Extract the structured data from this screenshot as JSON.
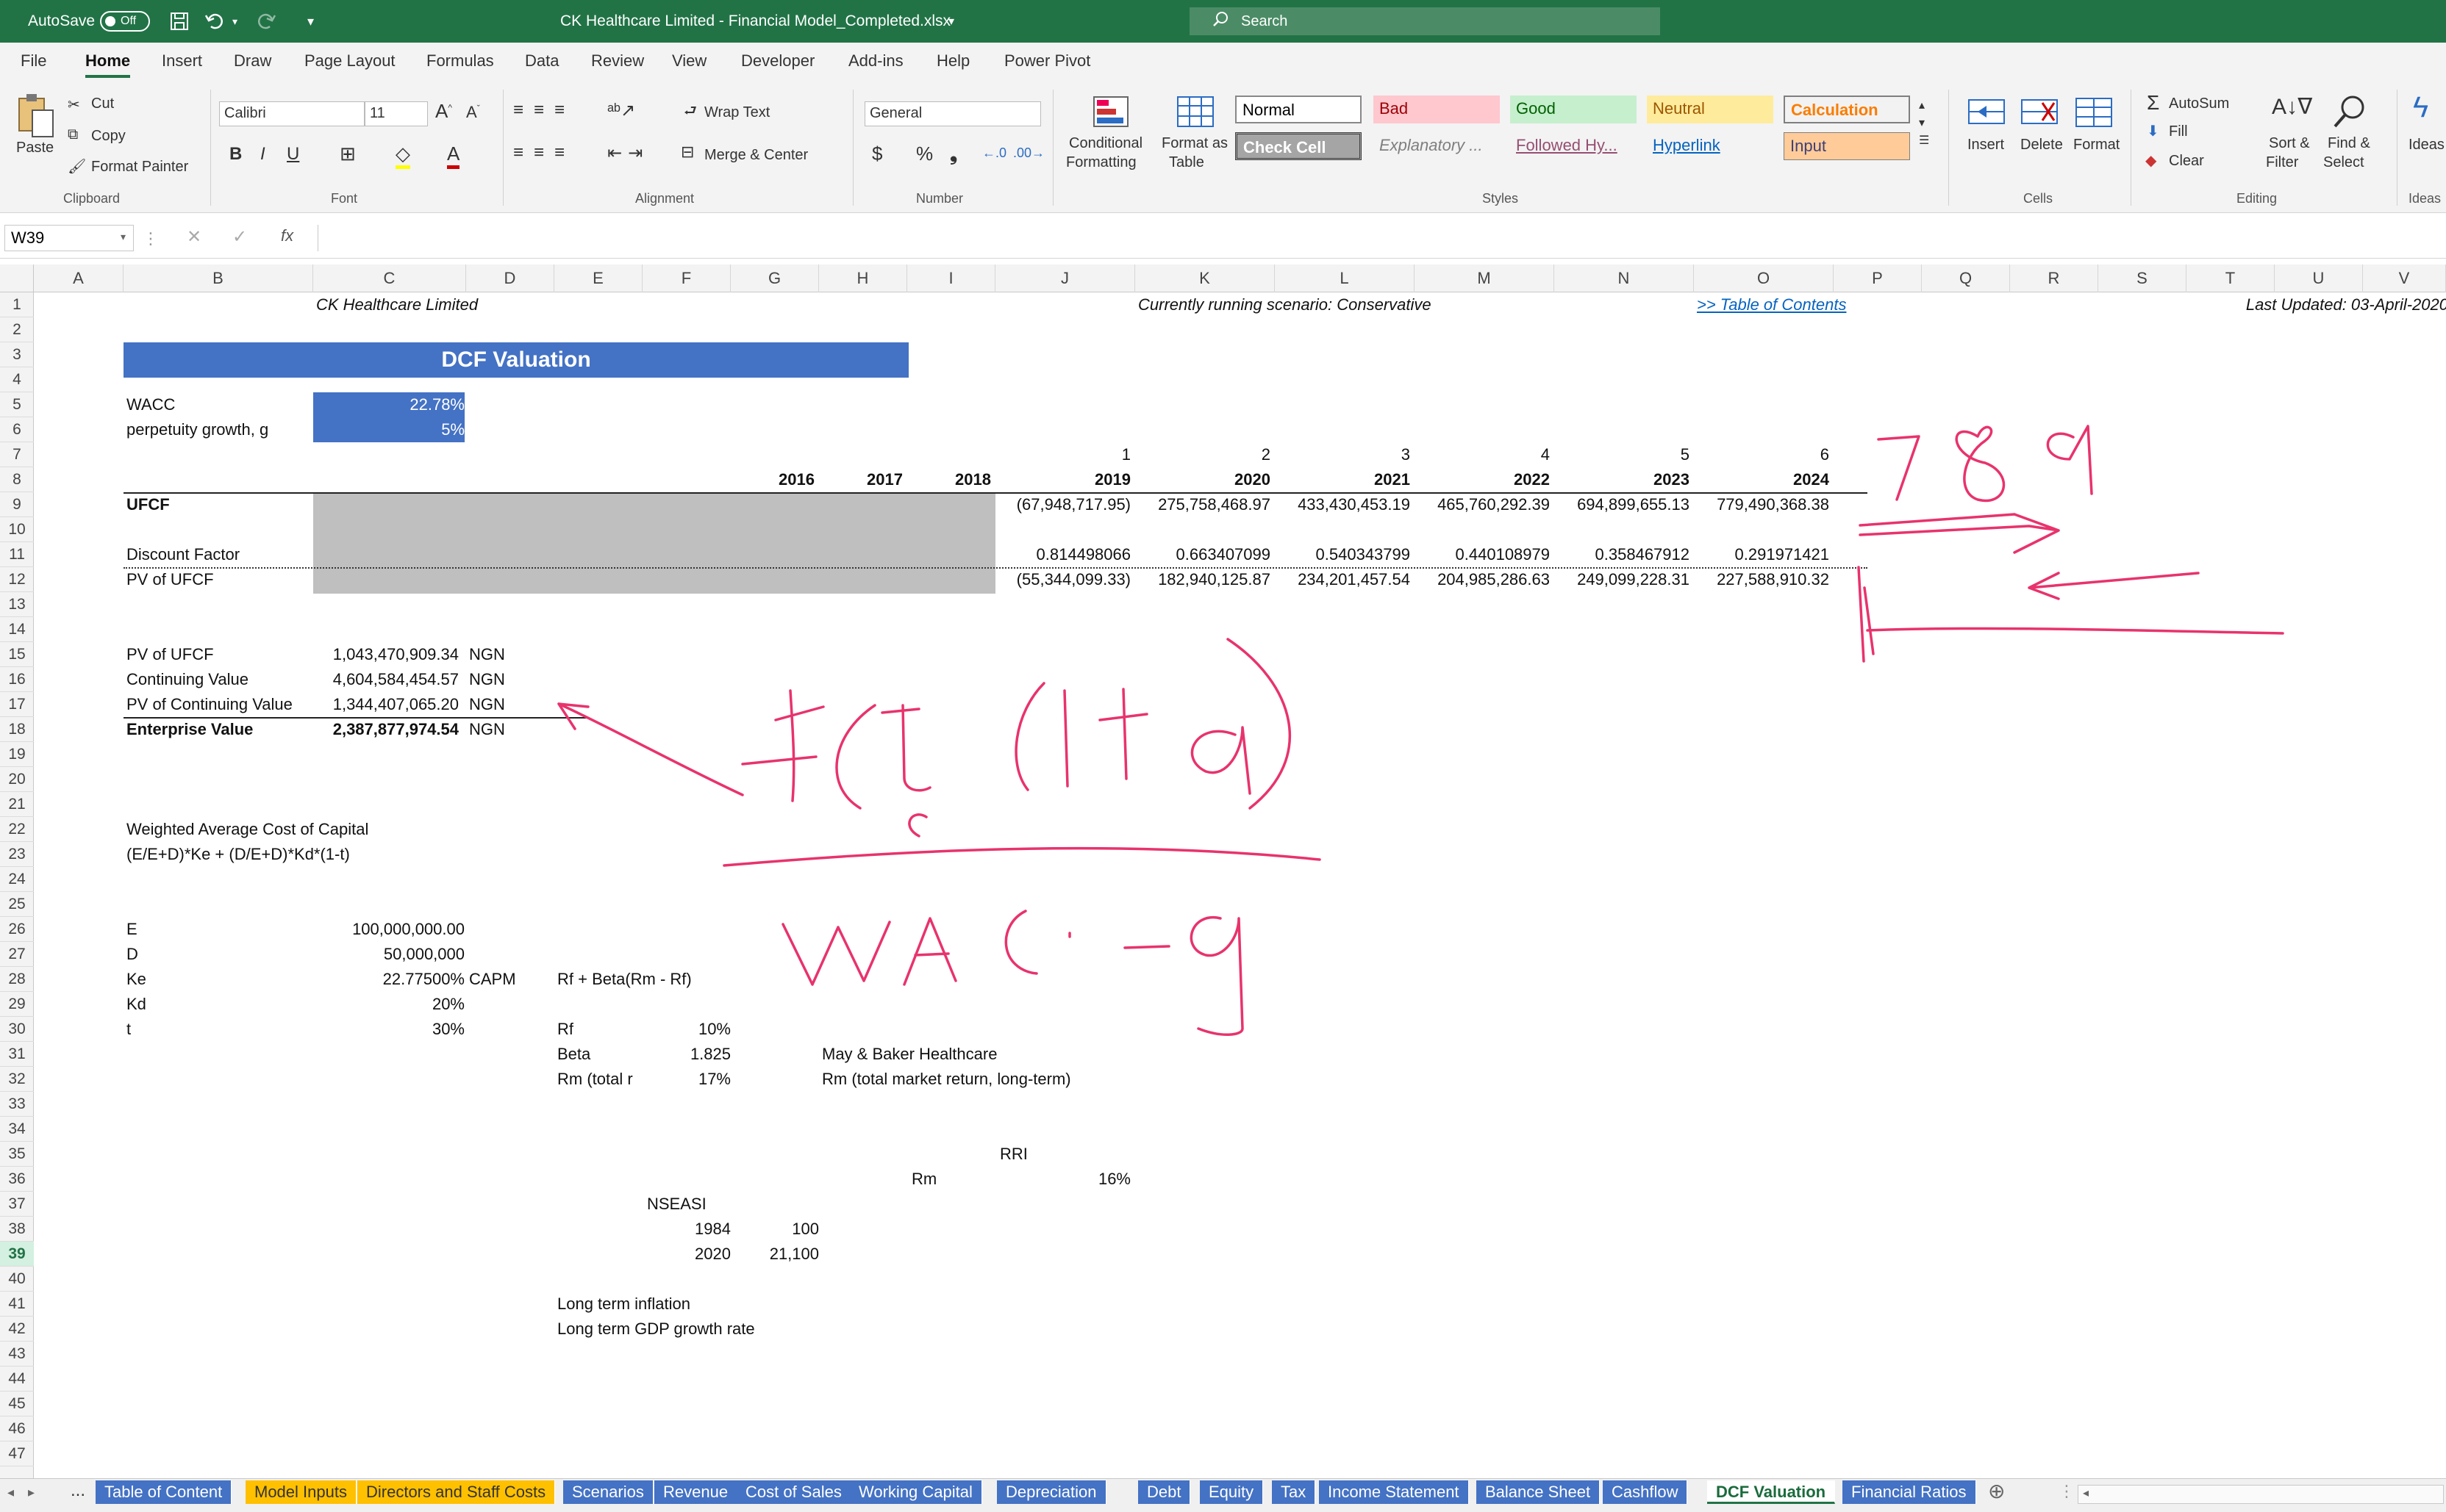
{
  "titlebar": {
    "autosave": "AutoSave",
    "toggle": "Off",
    "filename": "CK Healthcare Limited  -  Financial Model_Completed.xlsx",
    "search": "Search"
  },
  "menu": [
    "File",
    "Home",
    "Insert",
    "Draw",
    "Page Layout",
    "Formulas",
    "Data",
    "Review",
    "View",
    "Developer",
    "Add-ins",
    "Help",
    "Power Pivot"
  ],
  "ribbon": {
    "paste": "Paste",
    "cut": "Cut",
    "copy": "Copy",
    "format_painter": "Format Painter",
    "clipboard": "Clipboard",
    "font_name": "Calibri",
    "font_size": "11",
    "font": "Font",
    "wrap_text": "Wrap Text",
    "merge_center": "Merge & Center",
    "alignment": "Alignment",
    "number_format": "General",
    "number": "Number",
    "cond_fmt_1": "Conditional",
    "cond_fmt_2": "Formatting",
    "fmt_table_1": "Format as",
    "fmt_table_2": "Table",
    "styles": {
      "normal": "Normal",
      "bad": "Bad",
      "good": "Good",
      "neutral": "Neutral",
      "calculation": "Calculation",
      "check_cell": "Check Cell",
      "explanatory": "Explanatory ...",
      "followed": "Followed Hy...",
      "hyperlink": "Hyperlink",
      "input": "Input"
    },
    "styles_label": "Styles",
    "insert": "Insert",
    "delete": "Delete",
    "format": "Format",
    "cells": "Cells",
    "autosum": "AutoSum",
    "fill": "Fill",
    "clear": "Clear",
    "sort_1": "Sort &",
    "sort_2": "Filter",
    "find_1": "Find &",
    "find_2": "Select",
    "editing": "Editing",
    "ideas": "Ideas"
  },
  "namebox": "W39",
  "columns": [
    "A",
    "B",
    "C",
    "D",
    "E",
    "F",
    "G",
    "H",
    "I",
    "J",
    "K",
    "L",
    "M",
    "N",
    "O",
    "P",
    "Q",
    "R",
    "S",
    "T",
    "U",
    "V"
  ],
  "sheet": {
    "company": "CK Healthcare Limited",
    "scenario": "Currently running scenario: Conservative",
    "toc": ">> Table of Contents",
    "updated": "Last Updated: 03-April-2020",
    "title": "DCF Valuation",
    "wacc_label": "WACC",
    "wacc_value": "22.78%",
    "g_label": "perpetuity growth, g",
    "g_value": "5%",
    "periods": [
      "1",
      "2",
      "3",
      "4",
      "5",
      "6"
    ],
    "years": [
      "2016",
      "2017",
      "2018",
      "2019",
      "2020",
      "2021",
      "2022",
      "2023",
      "2024"
    ],
    "ufcf_label": "UFCF",
    "ufcf": [
      "(67,948,717.95)",
      "275,758,468.97",
      "433,430,453.19",
      "465,760,292.39",
      "694,899,655.13",
      "779,490,368.38"
    ],
    "df_label": "Discount Factor",
    "df": [
      "0.814498066",
      "0.663407099",
      "0.540343799",
      "0.440108979",
      "0.358467912",
      "0.291971421"
    ],
    "pv_label": "PV of UFCF",
    "pv": [
      "(55,344,099.33)",
      "182,940,125.87",
      "234,201,457.54",
      "204,985,286.63",
      "249,099,228.31",
      "227,588,910.32"
    ],
    "summary": [
      {
        "label": "PV of UFCF",
        "value": "1,043,470,909.34",
        "unit": "NGN"
      },
      {
        "label": "Continuing Value",
        "value": "4,604,584,454.57",
        "unit": "NGN"
      },
      {
        "label": "PV of Continuing Value",
        "value": "1,344,407,065.20",
        "unit": "NGN"
      },
      {
        "label": "Enterprise Value",
        "value": "2,387,877,974.54",
        "unit": "NGN"
      }
    ],
    "wacc_title": "Weighted Average Cost of Capital",
    "wacc_formula": "(E/E+D)*Ke + (D/E+D)*Kd*(1-t)",
    "inputs": [
      {
        "label": "E",
        "value": "100,000,000.00",
        "note": ""
      },
      {
        "label": "D",
        "value": "50,000,000",
        "note": ""
      },
      {
        "label": "Ke",
        "value": "22.77500%",
        "note": "CAPM"
      },
      {
        "label": "Kd",
        "value": "20%",
        "note": ""
      },
      {
        "label": "t",
        "value": "30%",
        "note": ""
      }
    ],
    "capm_formula": "Rf + Beta(Rm - Rf)",
    "rf_label": "Rf",
    "rf": "10%",
    "beta_label": "Beta",
    "beta": "1.825",
    "rm_label": "Rm (total r",
    "rm": "17%",
    "peer": "May & Baker Healthcare",
    "rm_desc": "Rm (total market return, long-term)",
    "rri": "RRI",
    "rm2_label": "Rm",
    "rm2": "16%",
    "nseasi": "NSEASI",
    "y1": "1984",
    "v1": "100",
    "y2": "2020",
    "v2": "21,100",
    "infl": "Long term inflation",
    "gdp": "Long term GDP growth rate"
  },
  "tabs": [
    {
      "name": "Table of Content",
      "style": "blue"
    },
    {
      "name": "Model Inputs",
      "style": "yellow"
    },
    {
      "name": "Directors and Staff Costs",
      "style": "yellow"
    },
    {
      "name": "Scenarios",
      "style": "blue"
    },
    {
      "name": "Revenue",
      "style": "blue"
    },
    {
      "name": "Cost of Sales",
      "style": "blue"
    },
    {
      "name": "Working Capital",
      "style": "blue"
    },
    {
      "name": "Depreciation",
      "style": "blue"
    },
    {
      "name": "Debt",
      "style": "blue"
    },
    {
      "name": "Equity",
      "style": "blue"
    },
    {
      "name": "Tax",
      "style": "blue"
    },
    {
      "name": "Income Statement",
      "style": "blue"
    },
    {
      "name": "Balance Sheet",
      "style": "blue"
    },
    {
      "name": "Cashflow",
      "style": "blue"
    },
    {
      "name": "DCF Valuation",
      "style": "active"
    },
    {
      "name": "Financial Ratios",
      "style": "blue"
    }
  ],
  "tab_ellipsis": "...",
  "colors": {
    "excel_green": "#217346",
    "header_blue": "#4472c4",
    "tab_yellow": "#ffc000",
    "ink": "#e8336d",
    "grey_fill": "#bfbfbf"
  }
}
